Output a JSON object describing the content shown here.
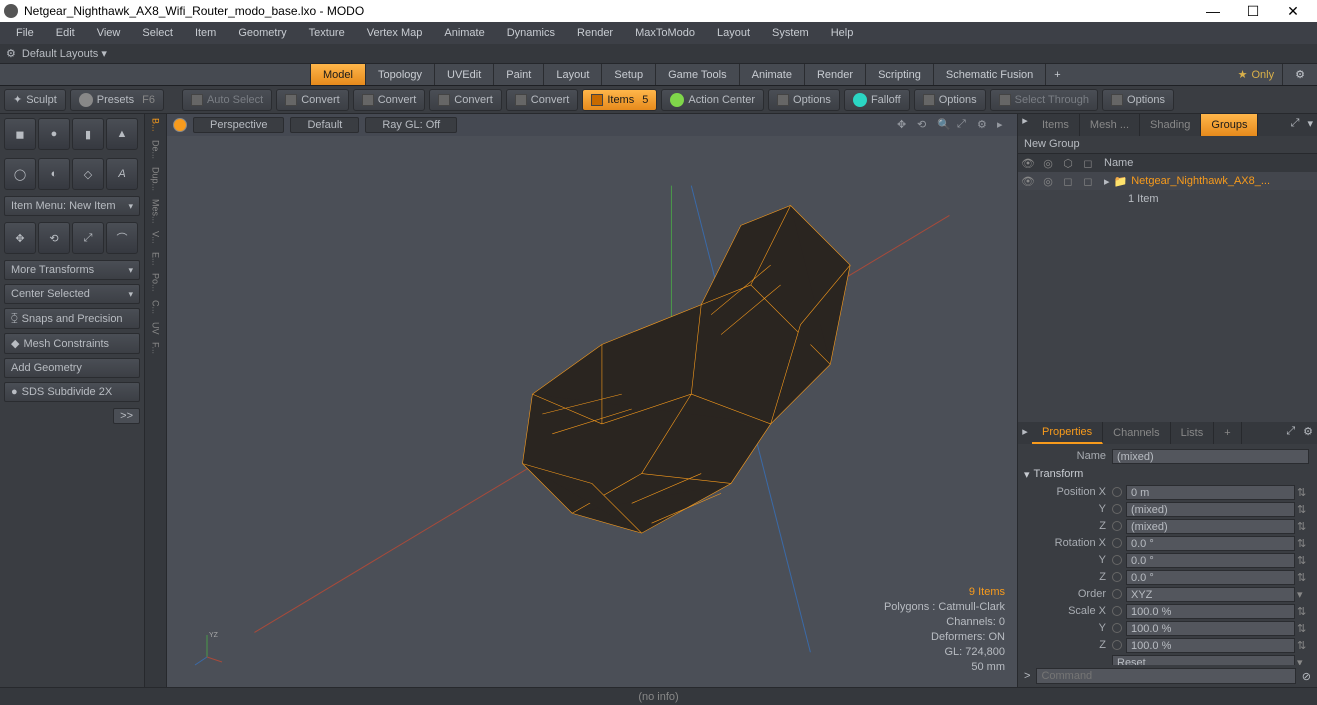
{
  "window": {
    "title": "Netgear_Nighthawk_AX8_Wifi_Router_modo_base.lxo - MODO",
    "min": "—",
    "max": "☐",
    "close": "✕"
  },
  "menu": [
    "File",
    "Edit",
    "View",
    "Select",
    "Item",
    "Geometry",
    "Texture",
    "Vertex Map",
    "Animate",
    "Dynamics",
    "Render",
    "MaxToModo",
    "Layout",
    "System",
    "Help"
  ],
  "layout_label": "Default Layouts ▾",
  "tabs": [
    "Model",
    "Topology",
    "UVEdit",
    "Paint",
    "Layout",
    "Setup",
    "Game Tools",
    "Animate",
    "Render",
    "Scripting",
    "Schematic Fusion"
  ],
  "tabs_active": 0,
  "tabs_plus": "+",
  "only_label": "Only",
  "toolbar": {
    "sculpt": "Sculpt",
    "presets": "Presets",
    "presets_key": "F6",
    "autoselect": "Auto Select",
    "convert": "Convert",
    "items": "Items",
    "items_badge": "5",
    "actioncenter": "Action Center",
    "options": "Options",
    "falloff": "Falloff",
    "selectthrough": "Select Through"
  },
  "left": {
    "itemmenu": "Item Menu: New Item",
    "moretransforms": "More Transforms",
    "centerselected": "Center Selected",
    "snaps": "Snaps and Precision",
    "meshcons": "Mesh Constraints",
    "addgeo": "Add Geometry",
    "sds": "SDS Subdivide 2X",
    "more": ">>"
  },
  "vstrip": [
    "B...",
    "De...",
    "Dup...",
    "Mes...",
    "V...",
    "E...",
    "Po...",
    "C...",
    "UV",
    "F..."
  ],
  "viewport": {
    "view": "Perspective",
    "shade": "Default",
    "raygl": "Ray GL: Off",
    "info_items": "9 Items",
    "info_poly": "Polygons : Catmull-Clark",
    "info_chan": "Channels: 0",
    "info_def": "Deformers: ON",
    "info_gl": "GL: 724,800",
    "info_scale": "50 mm",
    "axislabel": "YZ"
  },
  "rtabs_top": [
    "Items",
    "Mesh ...",
    "Shading",
    "Groups"
  ],
  "rtabs_top_dim": [
    0,
    1,
    2
  ],
  "rtabs_top_active": 3,
  "newgroup": "New Group",
  "tree_name": "Name",
  "tree_item": "Netgear_Nighthawk_AX8_...",
  "tree_count": "1 Item",
  "rtabs_bot": [
    "Properties",
    "Channels",
    "Lists",
    "+"
  ],
  "rtabs_bot_active": 0,
  "props": {
    "name_lbl": "Name",
    "name_val": "(mixed)",
    "transform": "Transform",
    "posx_lbl": "Position X",
    "posx": "0 m",
    "y_lbl": "Y",
    "posy": "(mixed)",
    "z_lbl": "Z",
    "posz": "(mixed)",
    "rotx_lbl": "Rotation X",
    "rotx": "0.0 °",
    "roty": "0.0 °",
    "rotz": "0.0 °",
    "order_lbl": "Order",
    "order": "XYZ",
    "sclx_lbl": "Scale X",
    "sclx": "100.0 %",
    "scly": "100.0 %",
    "sclz": "100.0 %",
    "reset": "Reset",
    "more": ">>"
  },
  "footer": {
    "noinfo": "(no info)",
    "cmd_ph": "Command",
    "chev": ">"
  }
}
